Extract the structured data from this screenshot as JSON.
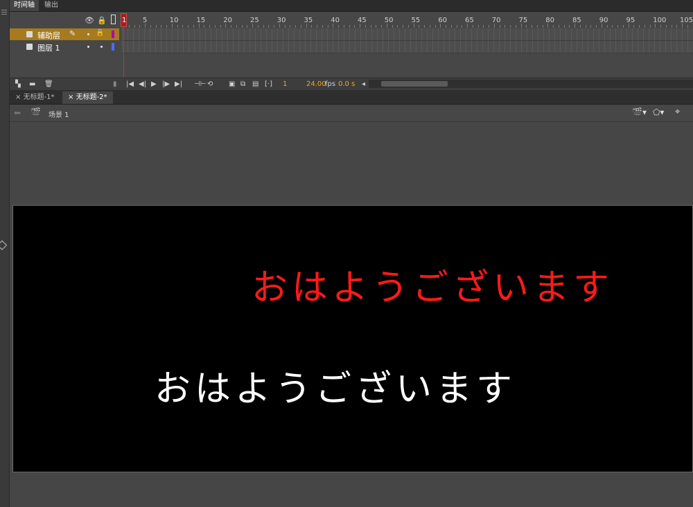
{
  "panel_tabs": [
    {
      "label": "时间轴",
      "active": true
    },
    {
      "label": "输出",
      "active": false
    }
  ],
  "timeline": {
    "ruler_numbers": [
      "1",
      "5",
      "10",
      "15",
      "20",
      "25",
      "30",
      "35",
      "40",
      "45",
      "50",
      "55",
      "60",
      "65",
      "70",
      "75",
      "80",
      "85",
      "90",
      "95",
      "100",
      "105"
    ],
    "layers": [
      {
        "name": "辅助层",
        "selected": true,
        "color": "#b000b0"
      },
      {
        "name": "图层 1",
        "selected": false,
        "color": "#4a6cff"
      }
    ],
    "toolbar": {
      "frame": "1",
      "fps": "24.00",
      "fps_unit": "fps",
      "time": "0.0 s"
    }
  },
  "doc_tabs": [
    {
      "label": "无标题-1*",
      "active": false
    },
    {
      "label": "无标题-2*",
      "active": true
    }
  ],
  "scene": {
    "label": "场景 1"
  },
  "stage": {
    "text_red": "おはようございます",
    "text_white": "おはようございます"
  },
  "icons": [
    "eye-icon",
    "lock-icon",
    "outline-icon",
    "play-icon",
    "scene-icon",
    "back-arrow-icon"
  ]
}
